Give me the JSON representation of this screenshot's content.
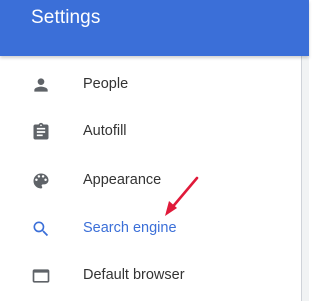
{
  "header": {
    "title": "Settings",
    "color": "#3b6fd8"
  },
  "sidebar": {
    "items": [
      {
        "label": "People",
        "icon": "person-icon",
        "active": false
      },
      {
        "label": "Autofill",
        "icon": "clipboard-icon",
        "active": false
      },
      {
        "label": "Appearance",
        "icon": "palette-icon",
        "active": false
      },
      {
        "label": "Search engine",
        "icon": "search-icon",
        "active": true
      },
      {
        "label": "Default browser",
        "icon": "browser-window-icon",
        "active": false
      }
    ]
  },
  "annotation": {
    "icon": "red-arrow-icon",
    "color": "#e01a3a"
  }
}
